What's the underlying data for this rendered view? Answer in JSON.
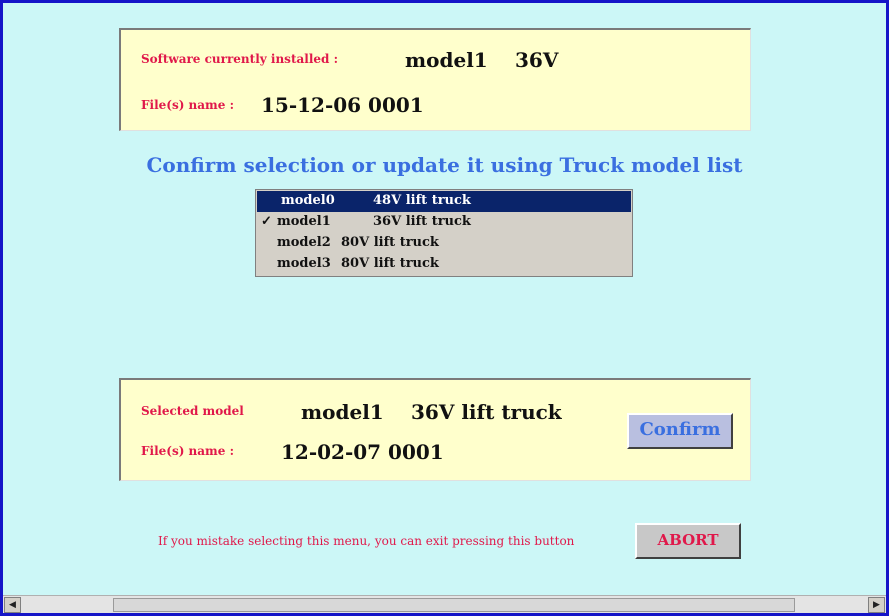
{
  "installed": {
    "software_label": "Software currently installed :",
    "model": "model1",
    "voltage": "36V",
    "files_label": "File(s) name :",
    "files_value": "15-12-06 0001"
  },
  "heading": "Confirm selection or update it using Truck model list",
  "model_list": {
    "items": [
      {
        "model": "model0",
        "desc": "48V lift truck",
        "selected": true,
        "checked": false
      },
      {
        "model": "model1",
        "desc": "36V lift truck",
        "selected": false,
        "checked": true
      },
      {
        "model": "model2",
        "desc": "80V lift truck",
        "selected": false,
        "checked": false
      },
      {
        "model": "model3",
        "desc": "80V lift truck",
        "selected": false,
        "checked": false
      }
    ],
    "check_mark": "✓"
  },
  "selected": {
    "selected_label": "Selected model",
    "model": "model1",
    "desc": "36V lift truck",
    "files_label": "File(s) name :",
    "files_value": "12-02-07 0001"
  },
  "buttons": {
    "confirm": "Confirm",
    "abort": "ABORT"
  },
  "abort_note": "If you mistake selecting this menu, you can exit pressing this button",
  "scrollbar": {
    "left_arrow": "◀",
    "right_arrow": "▶"
  },
  "colors": {
    "background": "#ccf7f7",
    "panel": "#ffffcc",
    "label_red": "#e0184a",
    "heading_blue": "#3a6fe0",
    "selection": "#0a246a"
  }
}
